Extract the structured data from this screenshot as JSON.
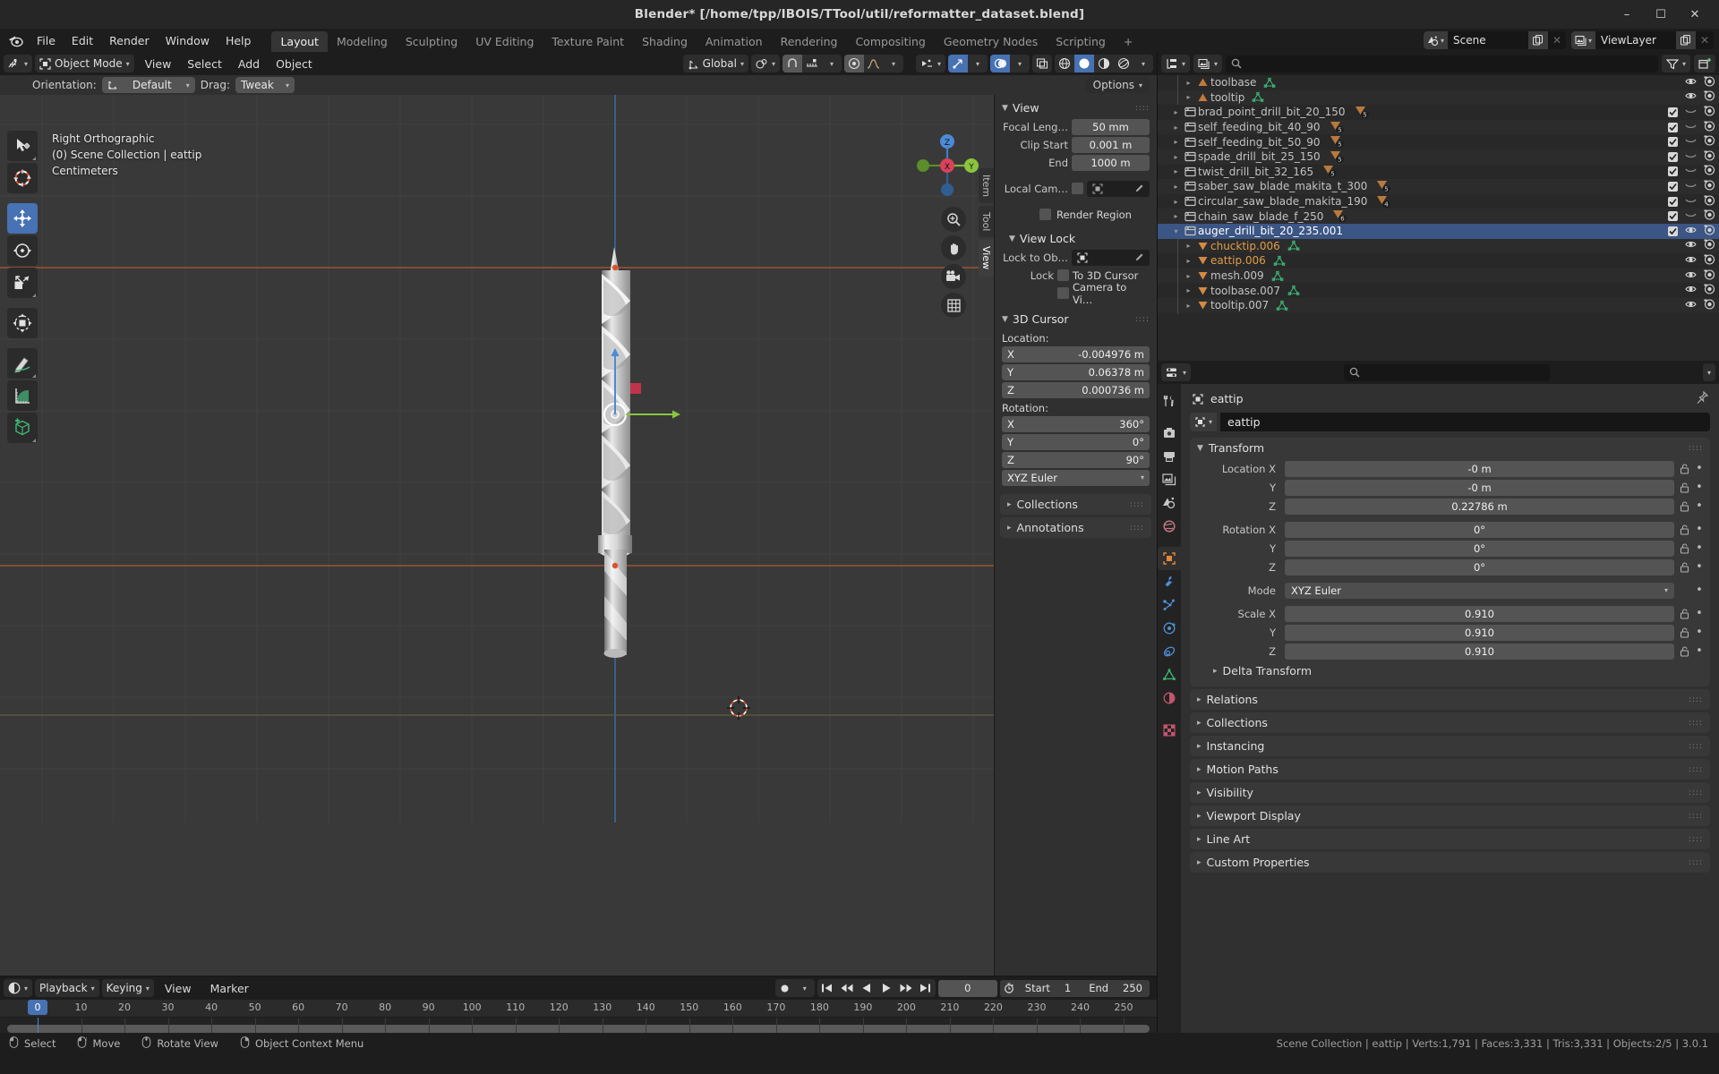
{
  "window": {
    "title": "Blender* [/home/tpp/IBOIS/TTool/util/reformatter_dataset.blend]",
    "minimize": "–",
    "maximize": "☐",
    "close": "✕"
  },
  "topbar": {
    "menus": [
      "File",
      "Edit",
      "Render",
      "Window",
      "Help"
    ],
    "workspaces": [
      {
        "label": "Layout",
        "active": true
      },
      {
        "label": "Modeling",
        "active": false
      },
      {
        "label": "Sculpting",
        "active": false
      },
      {
        "label": "UV Editing",
        "active": false
      },
      {
        "label": "Texture Paint",
        "active": false
      },
      {
        "label": "Shading",
        "active": false
      },
      {
        "label": "Animation",
        "active": false
      },
      {
        "label": "Rendering",
        "active": false
      },
      {
        "label": "Compositing",
        "active": false
      },
      {
        "label": "Geometry Nodes",
        "active": false
      },
      {
        "label": "Scripting",
        "active": false
      }
    ],
    "add_workspace": "+",
    "scene_name": "Scene",
    "viewlayer_name": "ViewLayer"
  },
  "viewport_header": {
    "mode": "Object Mode",
    "menus": [
      "View",
      "Select",
      "Add",
      "Object"
    ],
    "transform_orientation": "Global",
    "options_label": "Options"
  },
  "tool_settings": {
    "orientation_label": "Orientation:",
    "orientation_value": "Default",
    "drag_label": "Drag:",
    "drag_value": "Tweak"
  },
  "viewport": {
    "overlay_line1": "Right Orthographic",
    "overlay_line2": "(0) Scene Collection | eattip",
    "overlay_line3": "Centimeters",
    "gizmo_axes": [
      "X",
      "Y",
      "Z"
    ],
    "tools": [
      "tweak-tool",
      "cursor-tool",
      "move-tool",
      "rotate-tool",
      "scale-tool",
      "transform-tool",
      "annotate-tool",
      "measure-tool",
      "add-cube-tool"
    ],
    "active_tool_index": 2
  },
  "npanel": {
    "tabs": [
      {
        "label": "Item"
      },
      {
        "label": "Tool"
      },
      {
        "label": "View",
        "active": true
      }
    ],
    "view": {
      "title": "View",
      "rows": [
        {
          "label": "Focal Leng…",
          "value": "50 mm"
        },
        {
          "label": "Clip Start",
          "value": "0.001 m"
        },
        {
          "label": "End",
          "value": "1000 m"
        }
      ],
      "local_camera_label": "Local Cam…",
      "render_region_label": "Render Region"
    },
    "view_lock": {
      "title": "View Lock",
      "lock_to_object_label": "Lock to Ob…",
      "lock_label": "Lock",
      "to_3d_cursor": "To 3D Cursor",
      "camera_to_view": "Camera to Vi…"
    },
    "cursor3d": {
      "title": "3D Cursor",
      "location_label": "Location:",
      "location": [
        {
          "axis": "X",
          "value": "-0.004976 m"
        },
        {
          "axis": "Y",
          "value": "0.06378 m"
        },
        {
          "axis": "Z",
          "value": "0.000736 m"
        }
      ],
      "rotation_label": "Rotation:",
      "rotation": [
        {
          "axis": "X",
          "value": "360°"
        },
        {
          "axis": "Y",
          "value": "0°"
        },
        {
          "axis": "Z",
          "value": "90°"
        }
      ],
      "mode": "XYZ Euler"
    },
    "closed": [
      "Collections",
      "Annotations"
    ]
  },
  "outliner": {
    "rows": [
      {
        "indent": 2,
        "tri": "▸",
        "icon": "mesh-data-icon",
        "name": "toolbase",
        "color": "grey",
        "badge": "tri-green",
        "eye": true,
        "camera": true,
        "checkbox": false,
        "selected": false
      },
      {
        "indent": 2,
        "tri": "▸",
        "icon": "mesh-data-icon",
        "name": "tooltip",
        "color": "grey",
        "badge": "tri-green",
        "eye": true,
        "camera": true,
        "checkbox": false,
        "selected": false
      },
      {
        "indent": 1,
        "tri": "▸",
        "icon": "collection-icon",
        "name": "brad_point_drill_bit_20_150",
        "color": "grey",
        "badge": "stack",
        "badge_count": "5",
        "eye": "dim",
        "camera": true,
        "checkbox": true,
        "selected": false
      },
      {
        "indent": 1,
        "tri": "▸",
        "icon": "collection-icon",
        "name": "self_feeding_bit_40_90",
        "color": "grey",
        "badge": "stack",
        "badge_count": "5",
        "eye": "dim",
        "camera": true,
        "checkbox": true,
        "selected": false
      },
      {
        "indent": 1,
        "tri": "▸",
        "icon": "collection-icon",
        "name": "self_feeding_bit_50_90",
        "color": "grey",
        "badge": "stack",
        "badge_count": "5",
        "eye": "dim",
        "camera": true,
        "checkbox": true,
        "selected": false
      },
      {
        "indent": 1,
        "tri": "▸",
        "icon": "collection-icon",
        "name": "spade_drill_bit_25_150",
        "color": "grey",
        "badge": "stack",
        "badge_count": "5",
        "eye": "dim",
        "camera": true,
        "checkbox": true,
        "selected": false
      },
      {
        "indent": 1,
        "tri": "▸",
        "icon": "collection-icon",
        "name": "twist_drill_bit_32_165",
        "color": "grey",
        "badge": "stack",
        "badge_count": "5",
        "eye": "dim",
        "camera": true,
        "checkbox": true,
        "selected": false
      },
      {
        "indent": 1,
        "tri": "▸",
        "icon": "collection-icon",
        "name": "saber_saw_blade_makita_t_300",
        "color": "grey",
        "badge": "stack",
        "badge_count": "5",
        "eye": "dim",
        "camera": true,
        "checkbox": true,
        "selected": false
      },
      {
        "indent": 1,
        "tri": "▸",
        "icon": "collection-icon",
        "name": "circular_saw_blade_makita_190",
        "color": "grey",
        "badge": "stack",
        "badge_count": "4",
        "eye": "dim",
        "camera": true,
        "checkbox": true,
        "selected": false
      },
      {
        "indent": 1,
        "tri": "▸",
        "icon": "collection-icon",
        "name": "chain_saw_blade_f_250",
        "color": "grey",
        "badge": "stack",
        "badge_count": "6",
        "eye": "dim",
        "camera": true,
        "checkbox": true,
        "selected": false
      },
      {
        "indent": 1,
        "tri": "▾",
        "icon": "collection-icon",
        "name": "auger_drill_bit_20_235.001",
        "color": "white",
        "badge": "none",
        "eye": true,
        "camera": true,
        "checkbox": true,
        "selected": true
      },
      {
        "indent": 2,
        "tri": "▸",
        "icon": "mesh-object-icon",
        "name": "chucktip.006",
        "color": "orange",
        "badge": "tri-green",
        "eye": true,
        "camera": true,
        "checkbox": false,
        "selected": false
      },
      {
        "indent": 2,
        "tri": "▸",
        "icon": "mesh-object-icon",
        "name": "eattip.006",
        "color": "orange",
        "badge": "tri-green",
        "eye": true,
        "camera": true,
        "checkbox": false,
        "selected": false
      },
      {
        "indent": 2,
        "tri": "▸",
        "icon": "mesh-object-icon",
        "name": "mesh.009",
        "color": "grey",
        "badge": "tri-green",
        "eye": true,
        "camera": true,
        "checkbox": false,
        "selected": false
      },
      {
        "indent": 2,
        "tri": "▸",
        "icon": "mesh-object-icon",
        "name": "toolbase.007",
        "color": "grey",
        "badge": "tri-green",
        "eye": true,
        "camera": true,
        "checkbox": false,
        "selected": false
      },
      {
        "indent": 2,
        "tri": "▸",
        "icon": "mesh-object-icon",
        "name": "tooltip.007",
        "color": "grey",
        "badge": "tri-green",
        "eye": true,
        "camera": true,
        "checkbox": false,
        "selected": false
      }
    ]
  },
  "properties": {
    "breadcrumb_object": "eattip",
    "id_name": "eattip",
    "transform": {
      "title": "Transform",
      "location": [
        {
          "label": "Location X",
          "value": "-0 m"
        },
        {
          "label": "Y",
          "value": "-0 m"
        },
        {
          "label": "Z",
          "value": "0.22786 m"
        }
      ],
      "rotation": [
        {
          "label": "Rotation X",
          "value": "0°"
        },
        {
          "label": "Y",
          "value": "0°"
        },
        {
          "label": "Z",
          "value": "0°"
        }
      ],
      "mode_label": "Mode",
      "mode_value": "XYZ Euler",
      "scale": [
        {
          "label": "Scale X",
          "value": "0.910"
        },
        {
          "label": "Y",
          "value": "0.910"
        },
        {
          "label": "Z",
          "value": "0.910"
        }
      ],
      "delta_transform": "Delta Transform"
    },
    "closed_panels": [
      "Relations",
      "Collections",
      "Instancing",
      "Motion Paths",
      "Visibility",
      "Viewport Display",
      "Line Art",
      "Custom Properties"
    ]
  },
  "timeline": {
    "menus": [
      "Playback",
      "Keying",
      "View",
      "Marker"
    ],
    "current_frame": "0",
    "start_label": "Start",
    "start_value": "1",
    "end_label": "End",
    "end_value": "250",
    "ticks": [
      "0",
      "10",
      "20",
      "30",
      "40",
      "50",
      "60",
      "70",
      "80",
      "90",
      "100",
      "110",
      "120",
      "130",
      "140",
      "150",
      "160",
      "170",
      "180",
      "190",
      "200",
      "210",
      "220",
      "230",
      "240",
      "250"
    ],
    "playhead_frame": "0"
  },
  "statusbar": {
    "hints": [
      {
        "label": "Select"
      },
      {
        "label": "Move"
      },
      {
        "label": "Rotate View"
      },
      {
        "label": "Object Context Menu"
      }
    ],
    "info": "Scene Collection | eattip | Verts:1,791 | Faces:3,331 | Tris:3,331 | Objects:2/5 | 3.0.1"
  },
  "colors": {
    "accent_blue": "#4772b3",
    "orange": "#e09c49",
    "axis_x": "#d9425a",
    "axis_y": "#8ac53e",
    "axis_z": "#4b8ad6",
    "grid": "#4a4a4a"
  }
}
